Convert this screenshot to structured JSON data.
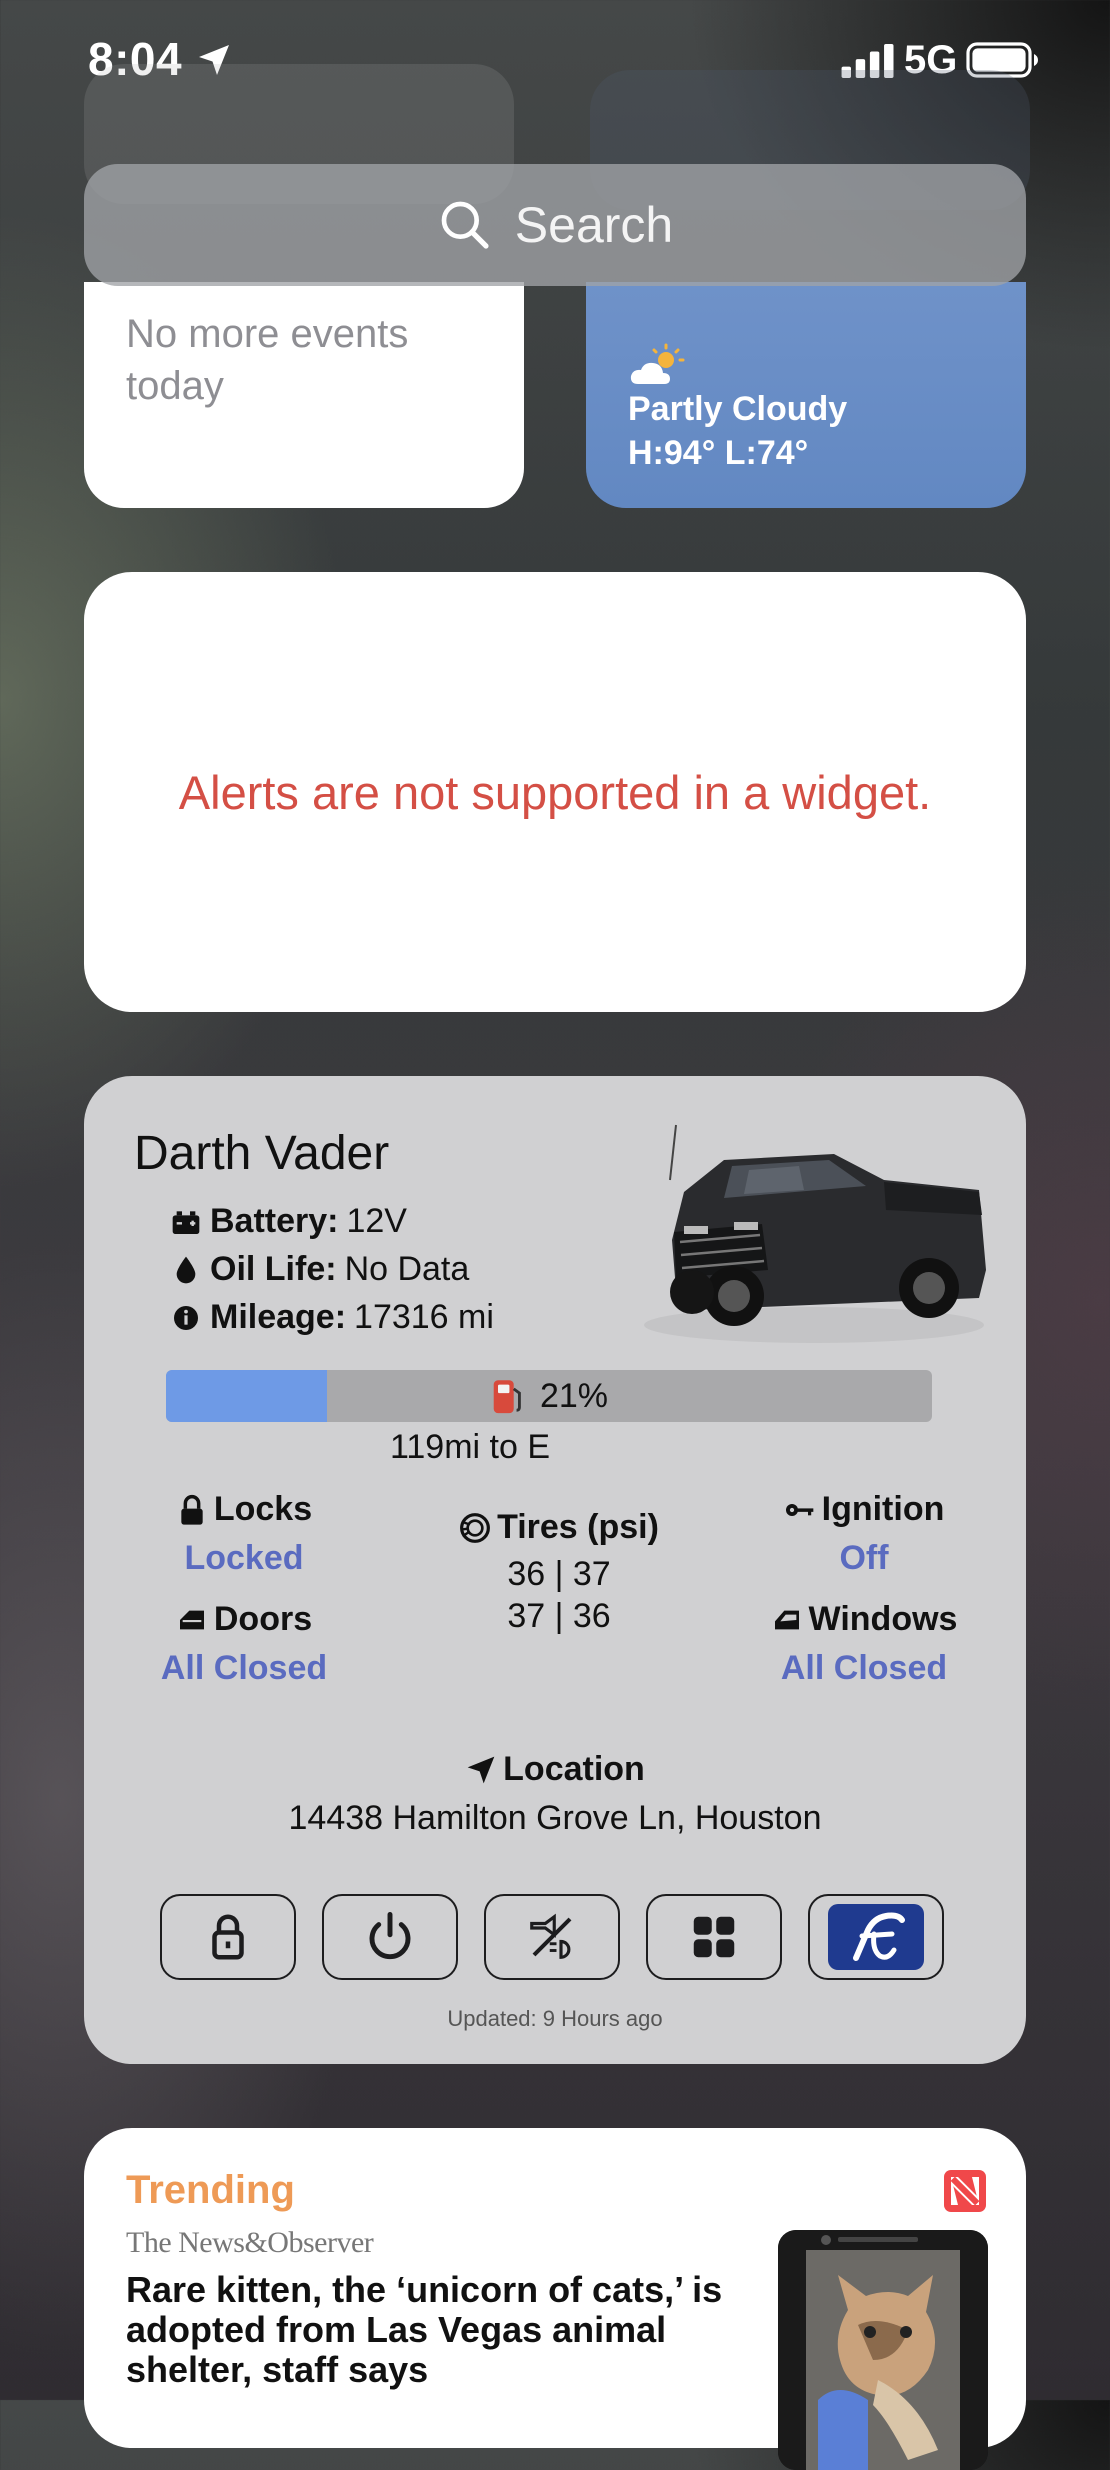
{
  "status_bar": {
    "time": "8:04",
    "network": "5G"
  },
  "search": {
    "label": "Search"
  },
  "calendar": {
    "text": "No more events today"
  },
  "weather": {
    "condition": "Partly Cloudy",
    "high_low": "H:94° L:74°"
  },
  "alert": {
    "message": "Alerts are not supported in a widget."
  },
  "vehicle": {
    "name": "Darth Vader",
    "battery_label": "Battery:",
    "battery_value": "12V",
    "oil_label": "Oil Life:",
    "oil_value": "No Data",
    "mileage_label": "Mileage:",
    "mileage_value": "17316 mi",
    "fuel_percent_text": "21%",
    "fuel_fraction": 0.21,
    "range": "119mi to E",
    "locks_label": "Locks",
    "locks_value": "Locked",
    "doors_label": "Doors",
    "doors_value": "All Closed",
    "tires_label": "Tires (psi)",
    "tires_front": "36 | 37",
    "tires_rear": "37 | 36",
    "ignition_label": "Ignition",
    "ignition_value": "Off",
    "windows_label": "Windows",
    "windows_value": "All Closed",
    "location_label": "Location",
    "location_value": "14438 Hamilton Grove Ln, Houston",
    "updated": "Updated: 9 Hours ago",
    "accent_color": "#5a6bc0",
    "fuel_color": "#6e9ae6"
  },
  "news": {
    "section": "Trending",
    "publisher": "The News&Observer",
    "headline": "Rare kitten, the ‘unicorn of cats,’ is adopted from Las Vegas animal shelter, staff says"
  }
}
